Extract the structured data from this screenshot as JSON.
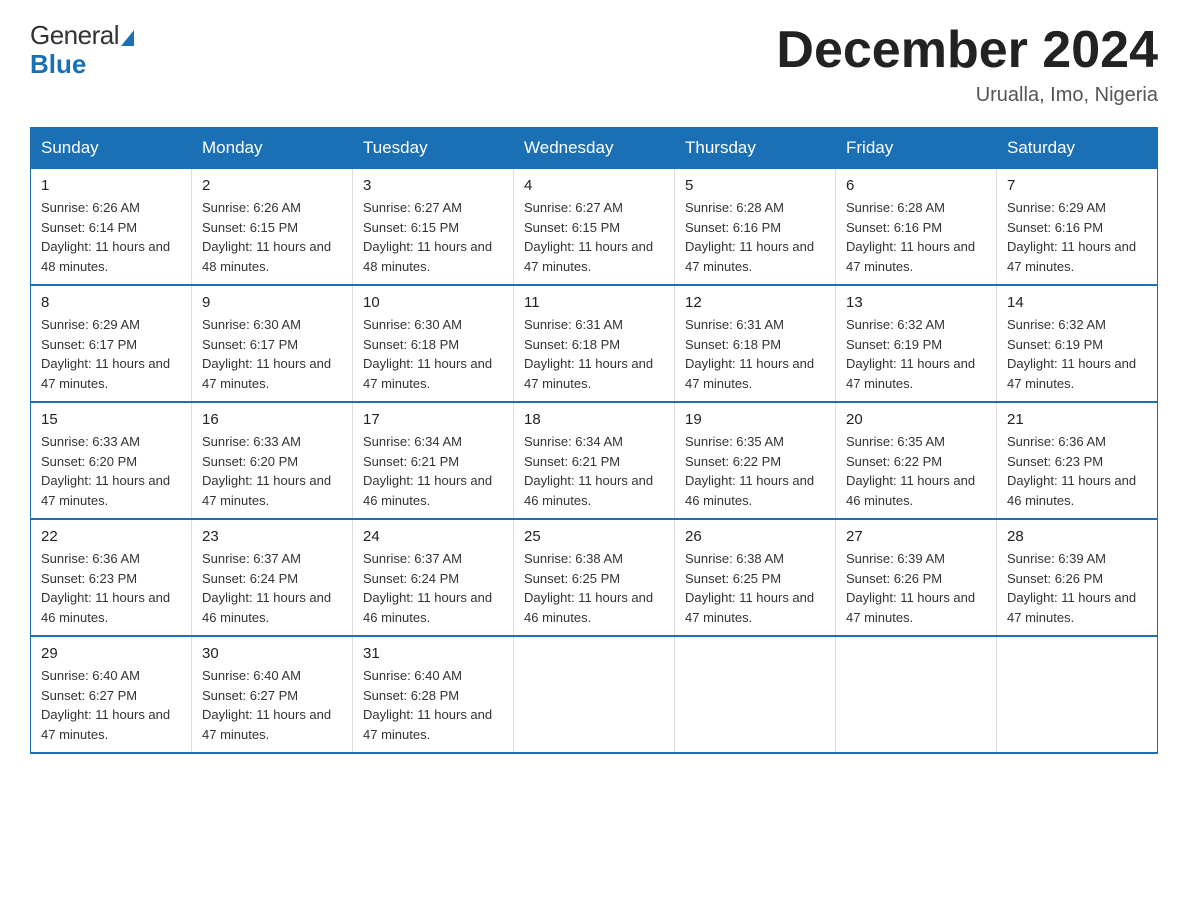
{
  "header": {
    "logo_general": "General",
    "logo_blue": "Blue",
    "title": "December 2024",
    "subtitle": "Urualla, Imo, Nigeria"
  },
  "calendar": {
    "days_of_week": [
      "Sunday",
      "Monday",
      "Tuesday",
      "Wednesday",
      "Thursday",
      "Friday",
      "Saturday"
    ],
    "weeks": [
      [
        {
          "day": "1",
          "sunrise": "Sunrise: 6:26 AM",
          "sunset": "Sunset: 6:14 PM",
          "daylight": "Daylight: 11 hours and 48 minutes."
        },
        {
          "day": "2",
          "sunrise": "Sunrise: 6:26 AM",
          "sunset": "Sunset: 6:15 PM",
          "daylight": "Daylight: 11 hours and 48 minutes."
        },
        {
          "day": "3",
          "sunrise": "Sunrise: 6:27 AM",
          "sunset": "Sunset: 6:15 PM",
          "daylight": "Daylight: 11 hours and 48 minutes."
        },
        {
          "day": "4",
          "sunrise": "Sunrise: 6:27 AM",
          "sunset": "Sunset: 6:15 PM",
          "daylight": "Daylight: 11 hours and 47 minutes."
        },
        {
          "day": "5",
          "sunrise": "Sunrise: 6:28 AM",
          "sunset": "Sunset: 6:16 PM",
          "daylight": "Daylight: 11 hours and 47 minutes."
        },
        {
          "day": "6",
          "sunrise": "Sunrise: 6:28 AM",
          "sunset": "Sunset: 6:16 PM",
          "daylight": "Daylight: 11 hours and 47 minutes."
        },
        {
          "day": "7",
          "sunrise": "Sunrise: 6:29 AM",
          "sunset": "Sunset: 6:16 PM",
          "daylight": "Daylight: 11 hours and 47 minutes."
        }
      ],
      [
        {
          "day": "8",
          "sunrise": "Sunrise: 6:29 AM",
          "sunset": "Sunset: 6:17 PM",
          "daylight": "Daylight: 11 hours and 47 minutes."
        },
        {
          "day": "9",
          "sunrise": "Sunrise: 6:30 AM",
          "sunset": "Sunset: 6:17 PM",
          "daylight": "Daylight: 11 hours and 47 minutes."
        },
        {
          "day": "10",
          "sunrise": "Sunrise: 6:30 AM",
          "sunset": "Sunset: 6:18 PM",
          "daylight": "Daylight: 11 hours and 47 minutes."
        },
        {
          "day": "11",
          "sunrise": "Sunrise: 6:31 AM",
          "sunset": "Sunset: 6:18 PM",
          "daylight": "Daylight: 11 hours and 47 minutes."
        },
        {
          "day": "12",
          "sunrise": "Sunrise: 6:31 AM",
          "sunset": "Sunset: 6:18 PM",
          "daylight": "Daylight: 11 hours and 47 minutes."
        },
        {
          "day": "13",
          "sunrise": "Sunrise: 6:32 AM",
          "sunset": "Sunset: 6:19 PM",
          "daylight": "Daylight: 11 hours and 47 minutes."
        },
        {
          "day": "14",
          "sunrise": "Sunrise: 6:32 AM",
          "sunset": "Sunset: 6:19 PM",
          "daylight": "Daylight: 11 hours and 47 minutes."
        }
      ],
      [
        {
          "day": "15",
          "sunrise": "Sunrise: 6:33 AM",
          "sunset": "Sunset: 6:20 PM",
          "daylight": "Daylight: 11 hours and 47 minutes."
        },
        {
          "day": "16",
          "sunrise": "Sunrise: 6:33 AM",
          "sunset": "Sunset: 6:20 PM",
          "daylight": "Daylight: 11 hours and 47 minutes."
        },
        {
          "day": "17",
          "sunrise": "Sunrise: 6:34 AM",
          "sunset": "Sunset: 6:21 PM",
          "daylight": "Daylight: 11 hours and 46 minutes."
        },
        {
          "day": "18",
          "sunrise": "Sunrise: 6:34 AM",
          "sunset": "Sunset: 6:21 PM",
          "daylight": "Daylight: 11 hours and 46 minutes."
        },
        {
          "day": "19",
          "sunrise": "Sunrise: 6:35 AM",
          "sunset": "Sunset: 6:22 PM",
          "daylight": "Daylight: 11 hours and 46 minutes."
        },
        {
          "day": "20",
          "sunrise": "Sunrise: 6:35 AM",
          "sunset": "Sunset: 6:22 PM",
          "daylight": "Daylight: 11 hours and 46 minutes."
        },
        {
          "day": "21",
          "sunrise": "Sunrise: 6:36 AM",
          "sunset": "Sunset: 6:23 PM",
          "daylight": "Daylight: 11 hours and 46 minutes."
        }
      ],
      [
        {
          "day": "22",
          "sunrise": "Sunrise: 6:36 AM",
          "sunset": "Sunset: 6:23 PM",
          "daylight": "Daylight: 11 hours and 46 minutes."
        },
        {
          "day": "23",
          "sunrise": "Sunrise: 6:37 AM",
          "sunset": "Sunset: 6:24 PM",
          "daylight": "Daylight: 11 hours and 46 minutes."
        },
        {
          "day": "24",
          "sunrise": "Sunrise: 6:37 AM",
          "sunset": "Sunset: 6:24 PM",
          "daylight": "Daylight: 11 hours and 46 minutes."
        },
        {
          "day": "25",
          "sunrise": "Sunrise: 6:38 AM",
          "sunset": "Sunset: 6:25 PM",
          "daylight": "Daylight: 11 hours and 46 minutes."
        },
        {
          "day": "26",
          "sunrise": "Sunrise: 6:38 AM",
          "sunset": "Sunset: 6:25 PM",
          "daylight": "Daylight: 11 hours and 47 minutes."
        },
        {
          "day": "27",
          "sunrise": "Sunrise: 6:39 AM",
          "sunset": "Sunset: 6:26 PM",
          "daylight": "Daylight: 11 hours and 47 minutes."
        },
        {
          "day": "28",
          "sunrise": "Sunrise: 6:39 AM",
          "sunset": "Sunset: 6:26 PM",
          "daylight": "Daylight: 11 hours and 47 minutes."
        }
      ],
      [
        {
          "day": "29",
          "sunrise": "Sunrise: 6:40 AM",
          "sunset": "Sunset: 6:27 PM",
          "daylight": "Daylight: 11 hours and 47 minutes."
        },
        {
          "day": "30",
          "sunrise": "Sunrise: 6:40 AM",
          "sunset": "Sunset: 6:27 PM",
          "daylight": "Daylight: 11 hours and 47 minutes."
        },
        {
          "day": "31",
          "sunrise": "Sunrise: 6:40 AM",
          "sunset": "Sunset: 6:28 PM",
          "daylight": "Daylight: 11 hours and 47 minutes."
        },
        null,
        null,
        null,
        null
      ]
    ]
  }
}
